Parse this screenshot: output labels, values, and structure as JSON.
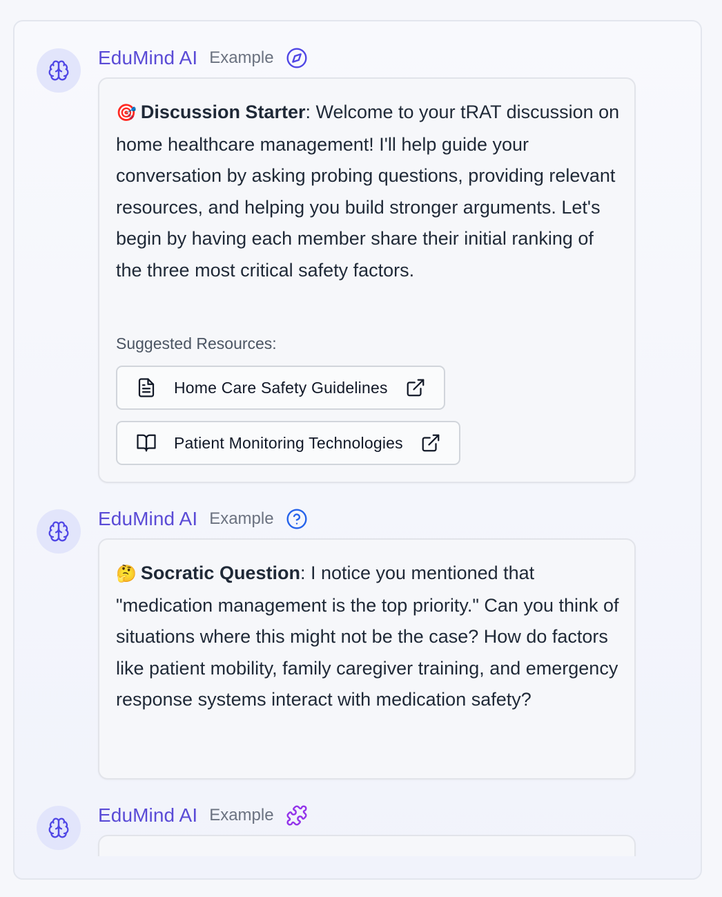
{
  "messages": [
    {
      "sender": "EduMind AI",
      "tag": "Example",
      "type_icon": "compass-icon",
      "emoji": "🎯",
      "title": "Discussion Starter",
      "body": ": Welcome to your tRAT discussion on home healthcare management! I'll help guide your conversation by asking probing questions, providing relevant resources, and helping you build stronger arguments. Let's begin by having each member share their initial ranking of the three most critical safety factors.",
      "resources_label": "Suggested Resources:",
      "resources": [
        {
          "icon": "document-icon",
          "label": "Home Care Safety Guidelines"
        },
        {
          "icon": "book-open-icon",
          "label": "Patient Monitoring Technologies"
        }
      ]
    },
    {
      "sender": "EduMind AI",
      "tag": "Example",
      "type_icon": "question-circle-icon",
      "emoji": "🤔",
      "title": "Socratic Question",
      "body": ": I notice you mentioned that \"medication management is the top priority.\" Can you think of situations where this might not be the case? How do factors like patient mobility, family caregiver training, and emergency response systems interact with medication safety?"
    },
    {
      "sender": "EduMind AI",
      "tag": "Example",
      "type_icon": "puzzle-icon"
    }
  ],
  "colors": {
    "sender": "#5a4bd6",
    "compass_icon": "#4f46e5",
    "question_icon": "#2563eb",
    "puzzle_icon": "#9333ea",
    "avatar_bg": "#e2e5fb"
  }
}
